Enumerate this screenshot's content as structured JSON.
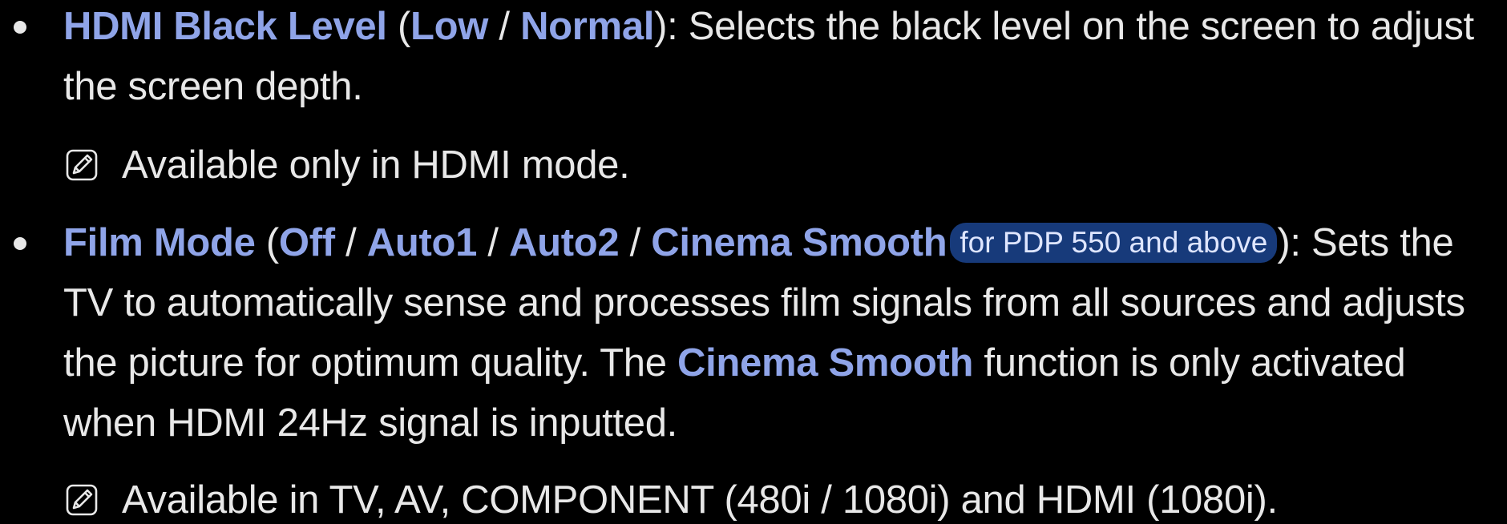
{
  "items": [
    {
      "name": "HDMI Black Level",
      "open_paren": " (",
      "options": [
        "Low",
        "Normal"
      ],
      "separator": " / ",
      "close_paren": ")",
      "description": ": Selects the black level on the screen to adjust the screen depth.",
      "note": "Available only in HDMI mode."
    },
    {
      "name": "Film Mode",
      "open_paren": " (",
      "options": [
        "Off",
        "Auto1",
        "Auto2",
        "Cinema Smooth"
      ],
      "separator": " / ",
      "badge": "for PDP 550 and above",
      "close_paren": ")",
      "description_1": ": Sets the TV to automatically sense and processes film signals from all sources and adjusts the picture for optimum quality. The ",
      "highlight": "Cinema Smooth",
      "description_2": " function is only activated when HDMI 24Hz signal is inputted.",
      "note": "Available in TV, AV, COMPONENT (480i / 1080i) and HDMI (1080i)."
    }
  ],
  "icons": {
    "note": "note-pencil-icon"
  },
  "colors": {
    "background": "#000000",
    "text": "#e8e8e8",
    "keyword": "#8fa4e8",
    "badge_bg": "#173a7a"
  }
}
